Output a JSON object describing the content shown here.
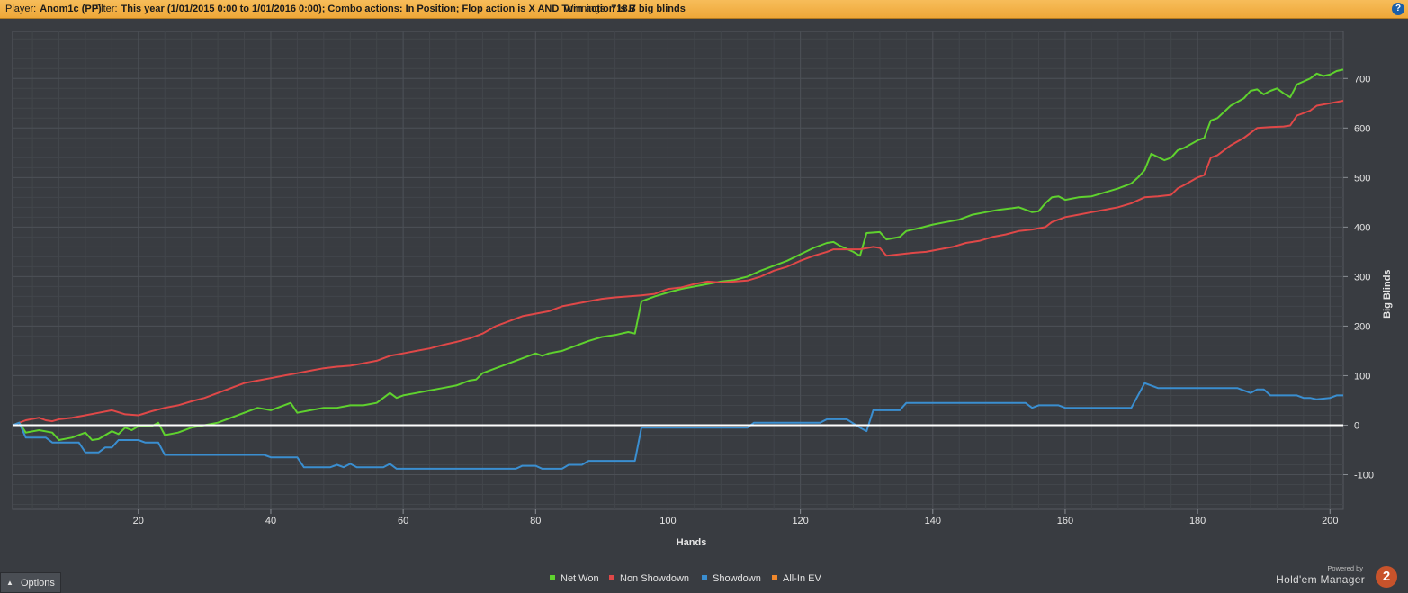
{
  "header": {
    "player_label": "Player:",
    "player_value": "Anom1c (PP)",
    "filter_label": "Filter:",
    "filter_value": "This year (1/01/2015 0:00 to 1/01/2016 0:00); Combo actions: In Position; Flop action is X AND Turn action is B",
    "winnings_label": "Winnings:",
    "winnings_value": "718.7 big blinds",
    "help_icon": "?"
  },
  "footer": {
    "options_label": "Options",
    "options_icon": "^",
    "powered_by": "Powered by",
    "brand_name": "Hold'em Manager",
    "brand_badge": "2"
  },
  "chart_data": {
    "type": "line",
    "xlabel": "Hands",
    "ylabel": "Big Blinds",
    "xlim": [
      1,
      202
    ],
    "ylim": [
      -170,
      795
    ],
    "x_ticks": [
      20,
      40,
      60,
      80,
      100,
      120,
      140,
      160,
      180,
      200
    ],
    "y_ticks": [
      -100,
      0,
      100,
      200,
      300,
      400,
      500,
      600,
      700
    ],
    "grid": true,
    "zero_line": true,
    "legend_position": "bottom-center",
    "colors": {
      "background": "#393c41",
      "grid": "#4c5056",
      "zero_line": "#ffffff",
      "axis_text": "#e5e5e5"
    },
    "series": [
      {
        "name": "Net Won",
        "color": "#5fd22e",
        "points": [
          [
            1,
            0
          ],
          [
            2,
            5
          ],
          [
            3,
            -15
          ],
          [
            5,
            -10
          ],
          [
            7,
            -15
          ],
          [
            8,
            -30
          ],
          [
            10,
            -25
          ],
          [
            12,
            -15
          ],
          [
            13,
            -30
          ],
          [
            14,
            -28
          ],
          [
            16,
            -12
          ],
          [
            17,
            -18
          ],
          [
            18,
            -5
          ],
          [
            19,
            -10
          ],
          [
            20,
            -2
          ],
          [
            22,
            -2
          ],
          [
            23,
            5
          ],
          [
            24,
            -20
          ],
          [
            26,
            -15
          ],
          [
            28,
            -5
          ],
          [
            30,
            0
          ],
          [
            32,
            5
          ],
          [
            34,
            15
          ],
          [
            36,
            25
          ],
          [
            38,
            35
          ],
          [
            40,
            30
          ],
          [
            42,
            40
          ],
          [
            43,
            45
          ],
          [
            44,
            25
          ],
          [
            46,
            30
          ],
          [
            48,
            35
          ],
          [
            50,
            35
          ],
          [
            52,
            40
          ],
          [
            54,
            40
          ],
          [
            56,
            45
          ],
          [
            58,
            65
          ],
          [
            59,
            55
          ],
          [
            60,
            60
          ],
          [
            62,
            65
          ],
          [
            64,
            70
          ],
          [
            66,
            75
          ],
          [
            68,
            80
          ],
          [
            70,
            90
          ],
          [
            71,
            92
          ],
          [
            72,
            105
          ],
          [
            74,
            115
          ],
          [
            76,
            125
          ],
          [
            78,
            135
          ],
          [
            80,
            145
          ],
          [
            81,
            140
          ],
          [
            82,
            145
          ],
          [
            84,
            150
          ],
          [
            86,
            160
          ],
          [
            88,
            170
          ],
          [
            90,
            178
          ],
          [
            92,
            182
          ],
          [
            94,
            188
          ],
          [
            95,
            185
          ],
          [
            96,
            250
          ],
          [
            98,
            260
          ],
          [
            100,
            268
          ],
          [
            102,
            275
          ],
          [
            104,
            280
          ],
          [
            106,
            285
          ],
          [
            108,
            290
          ],
          [
            110,
            293
          ],
          [
            112,
            300
          ],
          [
            114,
            312
          ],
          [
            116,
            322
          ],
          [
            118,
            332
          ],
          [
            120,
            345
          ],
          [
            122,
            358
          ],
          [
            124,
            368
          ],
          [
            125,
            370
          ],
          [
            126,
            362
          ],
          [
            128,
            350
          ],
          [
            129,
            342
          ],
          [
            130,
            388
          ],
          [
            132,
            390
          ],
          [
            133,
            375
          ],
          [
            135,
            380
          ],
          [
            136,
            392
          ],
          [
            138,
            398
          ],
          [
            140,
            405
          ],
          [
            142,
            410
          ],
          [
            144,
            415
          ],
          [
            146,
            425
          ],
          [
            148,
            430
          ],
          [
            150,
            435
          ],
          [
            152,
            438
          ],
          [
            153,
            440
          ],
          [
            155,
            430
          ],
          [
            156,
            432
          ],
          [
            157,
            448
          ],
          [
            158,
            460
          ],
          [
            159,
            462
          ],
          [
            160,
            455
          ],
          [
            162,
            460
          ],
          [
            164,
            462
          ],
          [
            166,
            470
          ],
          [
            168,
            478
          ],
          [
            170,
            488
          ],
          [
            171,
            500
          ],
          [
            172,
            515
          ],
          [
            173,
            548
          ],
          [
            175,
            535
          ],
          [
            176,
            540
          ],
          [
            177,
            555
          ],
          [
            178,
            560
          ],
          [
            180,
            575
          ],
          [
            181,
            580
          ],
          [
            182,
            615
          ],
          [
            183,
            620
          ],
          [
            185,
            645
          ],
          [
            187,
            660
          ],
          [
            188,
            675
          ],
          [
            189,
            678
          ],
          [
            190,
            668
          ],
          [
            191,
            675
          ],
          [
            192,
            680
          ],
          [
            193,
            670
          ],
          [
            194,
            662
          ],
          [
            195,
            688
          ],
          [
            197,
            700
          ],
          [
            198,
            710
          ],
          [
            199,
            705
          ],
          [
            200,
            708
          ],
          [
            201,
            715
          ],
          [
            202,
            718
          ]
        ]
      },
      {
        "name": "Non Showdown",
        "color": "#e04848",
        "points": [
          [
            1,
            0
          ],
          [
            3,
            10
          ],
          [
            5,
            15
          ],
          [
            6,
            10
          ],
          [
            7,
            8
          ],
          [
            8,
            12
          ],
          [
            10,
            15
          ],
          [
            12,
            20
          ],
          [
            14,
            25
          ],
          [
            16,
            30
          ],
          [
            18,
            22
          ],
          [
            20,
            20
          ],
          [
            22,
            28
          ],
          [
            24,
            35
          ],
          [
            26,
            40
          ],
          [
            28,
            48
          ],
          [
            30,
            55
          ],
          [
            32,
            65
          ],
          [
            34,
            75
          ],
          [
            36,
            85
          ],
          [
            38,
            90
          ],
          [
            40,
            95
          ],
          [
            42,
            100
          ],
          [
            44,
            105
          ],
          [
            46,
            110
          ],
          [
            48,
            115
          ],
          [
            50,
            118
          ],
          [
            52,
            120
          ],
          [
            54,
            125
          ],
          [
            56,
            130
          ],
          [
            58,
            140
          ],
          [
            60,
            145
          ],
          [
            62,
            150
          ],
          [
            64,
            155
          ],
          [
            66,
            162
          ],
          [
            68,
            168
          ],
          [
            70,
            175
          ],
          [
            72,
            185
          ],
          [
            74,
            200
          ],
          [
            76,
            210
          ],
          [
            78,
            220
          ],
          [
            80,
            225
          ],
          [
            82,
            230
          ],
          [
            84,
            240
          ],
          [
            86,
            245
          ],
          [
            88,
            250
          ],
          [
            90,
            255
          ],
          [
            92,
            258
          ],
          [
            94,
            260
          ],
          [
            96,
            262
          ],
          [
            98,
            265
          ],
          [
            100,
            275
          ],
          [
            102,
            278
          ],
          [
            104,
            285
          ],
          [
            106,
            290
          ],
          [
            108,
            288
          ],
          [
            110,
            290
          ],
          [
            112,
            292
          ],
          [
            114,
            300
          ],
          [
            116,
            312
          ],
          [
            118,
            320
          ],
          [
            120,
            332
          ],
          [
            122,
            342
          ],
          [
            124,
            350
          ],
          [
            125,
            355
          ],
          [
            127,
            355
          ],
          [
            129,
            355
          ],
          [
            131,
            360
          ],
          [
            132,
            358
          ],
          [
            133,
            342
          ],
          [
            135,
            345
          ],
          [
            137,
            348
          ],
          [
            139,
            350
          ],
          [
            141,
            355
          ],
          [
            143,
            360
          ],
          [
            145,
            368
          ],
          [
            147,
            372
          ],
          [
            149,
            380
          ],
          [
            151,
            385
          ],
          [
            153,
            392
          ],
          [
            155,
            395
          ],
          [
            157,
            400
          ],
          [
            158,
            410
          ],
          [
            160,
            420
          ],
          [
            162,
            425
          ],
          [
            164,
            430
          ],
          [
            166,
            435
          ],
          [
            168,
            440
          ],
          [
            170,
            448
          ],
          [
            172,
            460
          ],
          [
            174,
            462
          ],
          [
            176,
            465
          ],
          [
            177,
            478
          ],
          [
            178,
            485
          ],
          [
            180,
            500
          ],
          [
            181,
            505
          ],
          [
            182,
            540
          ],
          [
            183,
            545
          ],
          [
            185,
            565
          ],
          [
            187,
            580
          ],
          [
            188,
            590
          ],
          [
            189,
            600
          ],
          [
            191,
            602
          ],
          [
            193,
            603
          ],
          [
            194,
            605
          ],
          [
            195,
            625
          ],
          [
            197,
            635
          ],
          [
            198,
            645
          ],
          [
            200,
            650
          ],
          [
            202,
            655
          ]
        ]
      },
      {
        "name": "Showdown",
        "color": "#3a8ed0",
        "points": [
          [
            1,
            0
          ],
          [
            2,
            5
          ],
          [
            3,
            -25
          ],
          [
            6,
            -25
          ],
          [
            7,
            -35
          ],
          [
            11,
            -35
          ],
          [
            12,
            -55
          ],
          [
            14,
            -55
          ],
          [
            15,
            -45
          ],
          [
            16,
            -45
          ],
          [
            17,
            -30
          ],
          [
            20,
            -30
          ],
          [
            21,
            -35
          ],
          [
            23,
            -35
          ],
          [
            24,
            -60
          ],
          [
            39,
            -60
          ],
          [
            40,
            -65
          ],
          [
            44,
            -65
          ],
          [
            45,
            -85
          ],
          [
            49,
            -85
          ],
          [
            50,
            -80
          ],
          [
            51,
            -85
          ],
          [
            52,
            -78
          ],
          [
            53,
            -85
          ],
          [
            57,
            -85
          ],
          [
            58,
            -78
          ],
          [
            59,
            -88
          ],
          [
            77,
            -88
          ],
          [
            78,
            -82
          ],
          [
            80,
            -82
          ],
          [
            81,
            -88
          ],
          [
            84,
            -88
          ],
          [
            85,
            -80
          ],
          [
            87,
            -80
          ],
          [
            88,
            -72
          ],
          [
            95,
            -72
          ],
          [
            96,
            -5
          ],
          [
            112,
            -5
          ],
          [
            113,
            5
          ],
          [
            123,
            5
          ],
          [
            124,
            12
          ],
          [
            127,
            12
          ],
          [
            129,
            -5
          ],
          [
            130,
            -12
          ],
          [
            131,
            30
          ],
          [
            135,
            30
          ],
          [
            136,
            45
          ],
          [
            154,
            45
          ],
          [
            155,
            35
          ],
          [
            156,
            40
          ],
          [
            159,
            40
          ],
          [
            160,
            35
          ],
          [
            170,
            35
          ],
          [
            172,
            85
          ],
          [
            174,
            75
          ],
          [
            186,
            75
          ],
          [
            188,
            65
          ],
          [
            189,
            72
          ],
          [
            190,
            72
          ],
          [
            191,
            60
          ],
          [
            195,
            60
          ],
          [
            196,
            55
          ],
          [
            197,
            55
          ],
          [
            198,
            52
          ],
          [
            200,
            55
          ],
          [
            201,
            60
          ],
          [
            202,
            60
          ]
        ]
      },
      {
        "name": "All-In EV",
        "color": "#f0882c",
        "points": []
      }
    ]
  }
}
